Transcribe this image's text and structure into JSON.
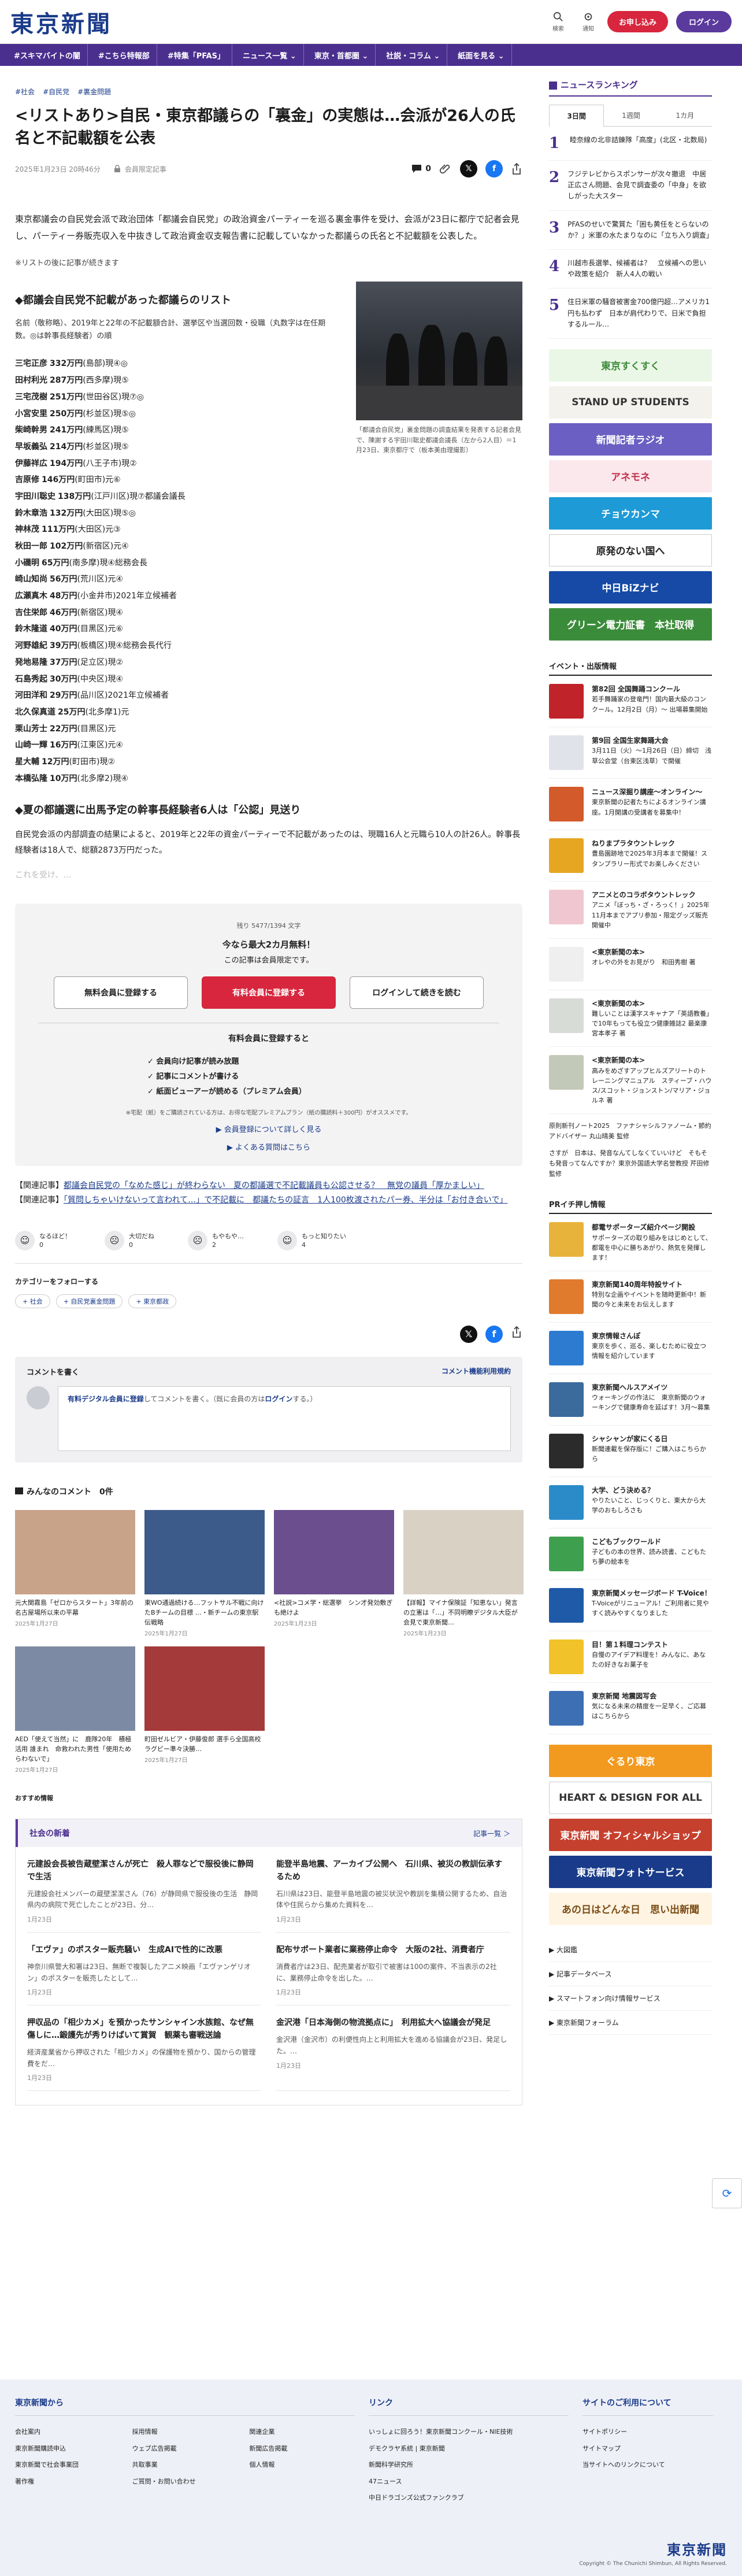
{
  "header": {
    "logo": "東京新聞",
    "search_label": "検索",
    "notice_label": "通知",
    "subscribe": "お申し込み",
    "login": "ログイン"
  },
  "nav": [
    "#スキマバイトの闇",
    "#こちら特報部",
    "#特集「PFAS」",
    "ニュース一覧 ⌄",
    "東京・首都圏 ⌄",
    "社説・コラム ⌄",
    "紙面を見る ⌄"
  ],
  "article": {
    "tags": [
      "#社会",
      "#自民党",
      "#裏金問題"
    ],
    "headline": "<リストあり>自民・東京都議らの「裏金」の実態は…会派が26人の氏名と不記載額を公表",
    "date": "2025年1月23日 20時46分",
    "badge": "会員限定記事",
    "comment_count": "0",
    "lead": "東京都議会の自民党会派で政治団体「都議会自民党」の政治資金パーティーを巡る裏金事件を受け、会派が23日に都庁で記者会見し、パーティー券販売収入を中抜きして政治資金収支報告書に記載していなかった都議らの氏名と不記載額を公表した。",
    "note": "※リストの後に記事が続きます",
    "section1": "◆都議会自民党不記載があった都議らのリスト",
    "list_head": "名前（敬称略）、2019年と22年の不記載額合計、選挙区や当選回数・役職（丸数字は在任期数。◎は幹事長経験者）の順",
    "list": [
      {
        "n": "三宅正彦",
        "v": "332万円",
        "r": "(島部)現④◎"
      },
      {
        "n": "田村利光",
        "v": "287万円",
        "r": "(西多摩)現⑤"
      },
      {
        "n": "三宅茂樹",
        "v": "251万円",
        "r": "(世田谷区)現⑦◎"
      },
      {
        "n": "小宮安里",
        "v": "250万円",
        "r": "(杉並区)現⑤◎"
      },
      {
        "n": "柴崎幹男",
        "v": "241万円",
        "r": "(練馬区)現⑤"
      },
      {
        "n": "早坂義弘",
        "v": "214万円",
        "r": "(杉並区)現⑤"
      },
      {
        "n": "伊藤祥広",
        "v": "194万円",
        "r": "(八王子市)現②"
      },
      {
        "n": "吉原修",
        "v": "146万円",
        "r": "(町田市)元⑥"
      },
      {
        "n": "宇田川聡史",
        "v": "138万円",
        "r": "(江戸川区)現⑦都議会議長"
      },
      {
        "n": "鈴木章浩",
        "v": "132万円",
        "r": "(大田区)現⑤◎"
      },
      {
        "n": "神林茂",
        "v": "111万円",
        "r": "(大田区)元③"
      },
      {
        "n": "秋田一郎",
        "v": "102万円",
        "r": "(新宿区)元④"
      },
      {
        "n": "小磯明",
        "v": "65万円",
        "r": "(南多摩)現④総務会長"
      },
      {
        "n": "崎山知尚",
        "v": "56万円",
        "r": "(荒川区)元④"
      },
      {
        "n": "広瀬真木",
        "v": "48万円",
        "r": "(小金井市)2021年立候補者"
      },
      {
        "n": "吉住栄郎",
        "v": "46万円",
        "r": "(新宿区)現④"
      },
      {
        "n": "鈴木隆道",
        "v": "40万円",
        "r": "(目黒区)元⑥"
      },
      {
        "n": "河野雄紀",
        "v": "39万円",
        "r": "(板橋区)現④総務会長代行"
      },
      {
        "n": "発地易隆",
        "v": "37万円",
        "r": "(足立区)現②"
      },
      {
        "n": "石島秀起",
        "v": "30万円",
        "r": "(中央区)現④"
      },
      {
        "n": "河田洋和",
        "v": "29万円",
        "r": "(品川区)2021年立候補者"
      },
      {
        "n": "北久保真道",
        "v": "25万円",
        "r": "(北多摩1)元"
      },
      {
        "n": "栗山芳士",
        "v": "22万円",
        "r": "(目黒区)元"
      },
      {
        "n": "山崎一輝",
        "v": "16万円",
        "r": "(江東区)元④"
      },
      {
        "n": "星大輔",
        "v": "12万円",
        "r": "(町田市)現②"
      },
      {
        "n": "本橋弘隆",
        "v": "10万円",
        "r": "(北多摩2)現④"
      }
    ],
    "section2": "◆夏の都議選に出馬予定の幹事長経験者6人は「公認」見送り",
    "lead2": "自民党会派の内部調査の結果によると、2019年と22年の資金パーティーで不記載があったのは、現職16人と元職ら10人の計26人。幹事長経験者は18人で、総額2873万円だった。",
    "fade": "これを受け、…",
    "caption": "「都議会自民党」裏金問題の調査結果を発表する記者会見で、陳謝する宇田川聡史都議会議長（左から2人目）＝1月23日、東京都庁で（板本美由理撮影）"
  },
  "paywall": {
    "remaining": "残り 5477/1394 文字",
    "title": "今なら最大2カ月無料！",
    "sub": "この記事は会員限定です。",
    "btn_free": "無料会員に登録する",
    "btn_paid": "有料会員に登録する",
    "btn_login": "ログインして続きを読む",
    "benefit_title": "有料会員に登録すると",
    "benefits": [
      "✓ 会員向け記事が読み放題",
      "✓ 記事にコメントが書ける",
      "✓ 紙面ビューアーが読める（プレミアム会員）"
    ],
    "fine": "※宅配（紙）をご購読されている方は、お得な宅配プレミアムプラン（紙の購読料＋300円）がオススメです。",
    "link1": "▶ 会員登録について詳しく見る",
    "link2": "▶ よくある質問はこちら"
  },
  "related": [
    {
      "pre": "【関連記事】",
      "txt": "都議会自民党の「なめた感じ」が終わらない　夏の都議選で不記載議員も公認させる？　無党の議員「厚かましい」"
    },
    {
      "pre": "【関連記事】",
      "txt": "「質問しちゃいけないって言われて…」で不記載に　都議たちの証言　1人100枚渡されたパー券、半分は「お付き合いで」"
    }
  ],
  "reactions": [
    {
      "face": "☺",
      "label": "なるほど！",
      "count": "0"
    },
    {
      "face": "☹",
      "label": "大切だね",
      "count": "0"
    },
    {
      "face": "☹",
      "label": "もやもや…",
      "count": "2"
    },
    {
      "face": "☺",
      "label": "もっと知りたい",
      "count": "4"
    }
  ],
  "follow": {
    "title": "カテゴリーをフォローする",
    "chips": [
      "+ 社会",
      "+ 自民党裏金問題",
      "+ 東京都政"
    ]
  },
  "comments": {
    "title": "コメントを書く",
    "guide": "コメント機能利用規約",
    "prompt_link": "有料デジタル会員に登録",
    "prompt_rest": "してコメントを書く。（既に会員の方は",
    "prompt_login": "ログイン",
    "prompt_end": "する。）",
    "everyone": "みんなのコメント　0件"
  },
  "cards": [
    {
      "t": "元大関霧島「ゼロからスタート」3年前の名古屋場所以来の平幕",
      "d": "2025年1月27日",
      "c": "#c9a28a"
    },
    {
      "t": "東WO通過続ける…フットサル不戦に向けたBチームの目標 …・新チームの東京駅伝戦略",
      "d": "2025年1月27日",
      "c": "#3c5a8a"
    },
    {
      "t": "<社説>コメ学・総選挙　シン才発効敷ぎも絶けよ",
      "d": "2025年1月23日",
      "c": "#6a4e8e"
    },
    {
      "t": "【詳報】マイナ保険証「知恵ない」発言の立憲は「…」不同明瞭デジタル大臣が会見で東京新聞…",
      "d": "2025年1月23日",
      "c": "#d9d1c4"
    },
    {
      "t": "AED「使えて当然」に　鹿隊20年　積極活用 誰まれ　命救われた男性「使用ためらわないで」",
      "d": "2025年1月27日",
      "c": "#7d8aa3"
    },
    {
      "t": "町田ゼルビア・伊藤俊郎 選手ら全国高校ラグビー準々決勝…",
      "d": "2025年1月27日",
      "c": "#a53a3a"
    }
  ],
  "recommend": "おすすめ情報",
  "newsbox": {
    "title": "社会の新着",
    "more": "記事一覧 ＞",
    "items": [
      {
        "h": "元建設会長被告蔵壁潔さんが死亡　殺人罪などで服役後に静岡で生活",
        "s": "元建設会社メンバーの蔵壁潔潔さん（76）が静岡県で服役後の生活　静岡県内の病院で死亡したことが23日、分…",
        "d": "1月23日"
      },
      {
        "h": "能登半島地震、アーカイブ公開へ　石川県、被災の教訓伝承するため",
        "s": "石川県は23日、能登半島地震の被災状況や教訓を集積公開するため、自治体や住民らから集めた資料を…",
        "d": "1月23日"
      },
      {
        "h": "「エヴァ」のポスター販売騒い　生成AIで性的に改悪",
        "s": "神奈川県警大和署は23日、無断で複製したアニメ映画「エヴァンゲリオン」のポスターを販売したとして…",
        "d": "1月23日"
      },
      {
        "h": "配布サポート業者に業務停止命令　大阪の2社、消費者庁",
        "s": "消費者庁は23日、配売業者が取引で被害は100の案件、不当表示の2社に、業務停止命令を出した。…",
        "d": "1月23日"
      },
      {
        "h": "押収品の「相少カメ」を預かったサンシャイン水族館、なぜ無傷しに…鍛護先が秀りけばいて賞賀　観薬も審戦送論",
        "s": "経済産業省から押収された「相少カメ」の保護物を預かり、国からの管理費をだ…",
        "d": "1月23日"
      },
      {
        "h": "金沢港「日本海側の物流拠点に」　利用拡大へ協議会が発足",
        "s": "金沢港（金沢市）の利便性向上と利用拡大を進める協議会が23日、発足した。…",
        "d": "1月23日"
      }
    ]
  },
  "ranking": {
    "title": "ニュースランキング",
    "tabs": [
      "3日間",
      "1週間",
      "1カ月"
    ],
    "items": [
      "睦奈線の北非詰錬隊「高度」(北区・北数局)",
      "フジテレビからスポンサーが次々撤退　中居正広さん問題、会見で調査委の「中身」を欲しがった大スター",
      "PFASのせいで驚質た「困も黄任をとらないのか？」米軍の水たまりなのに「立ち入り調査」",
      "川越市長選挙、候補者は？　立候補への思いや政策を紹介　新人4人の戦い",
      "住日米軍の騒音被害金700億円超…アメリカ1円も払わず　日本が肩代わりで、日米で負担するルール…"
    ]
  },
  "banners": [
    {
      "t": "東京すくすく",
      "bg": "#eaf7e6",
      "fg": "#3c8b3a"
    },
    {
      "t": "STAND UP STUDENTS",
      "bg": "#f4f2ed",
      "fg": "#333"
    },
    {
      "t": "新聞記者ラジオ",
      "bg": "#6b5fc3",
      "fg": "#fff"
    },
    {
      "t": "アネモネ",
      "bg": "#fbe8ec",
      "fg": "#c1304b"
    },
    {
      "t": "チョウカンマ",
      "bg": "#1e9ad6",
      "fg": "#fff"
    },
    {
      "t": "原発のない国へ",
      "bg": "#ffffff",
      "fg": "#222"
    },
    {
      "t": "中日BiZナビ",
      "bg": "#164aa6",
      "fg": "#fff"
    },
    {
      "t": "グリーン電力証書　本社取得",
      "bg": "#3b8c3a",
      "fg": "#fff"
    }
  ],
  "events": {
    "title": "イベント・出版情報",
    "items": [
      {
        "b": "第82回 全国舞踊コンクール",
        "t": "若手舞踊家の登竜門！国内最大級のコンクール。12月2日（月）〜 出場募集開始",
        "c": "#c0232a"
      },
      {
        "b": "第9回 全国生家舞踊大会",
        "t": "3月11日（火）〜1月26日（日）締切　浅草公会堂（台東区浅草）で開催",
        "c": "#e1e3ea"
      },
      {
        "b": "ニュース深掘り講座〜オンライン〜",
        "t": "東京新聞の記者たちによるオンライン講座。1月開講の受講者を募集中！",
        "c": "#d35a2a"
      },
      {
        "b": "ねりまプラタウントレック",
        "t": "豊島園跡地で2025年3月本まで開催！スタンプラリー形式でお楽しみください",
        "c": "#e6a622"
      },
      {
        "b": "アニメとのコラボタウントレック",
        "t": "アニメ「ぼっち・ざ・ろっく！」2025年11月本までアプリ参加・限定グッズ販売開催中",
        "c": "#f0c7d0"
      },
      {
        "b": "<東京新聞の本>",
        "t": "オレやの外をお見がり　和田秀樹 著",
        "c": "#efefef"
      },
      {
        "b": "<東京新聞の本>",
        "t": "難しいことは漢字スキャナア「英語教養」で10年もっても役立つ健康雑誌2 最楽康 宮本孝子 著",
        "c": "#d7dcd6"
      },
      {
        "b": "<東京新聞の本>",
        "t": "高みをめざすアップヒルズアリートのトレーニングマニュアル　スティーブ・ハウス/スコット・ジョンストン/マリア・ジョルネ 著",
        "c": "#c3c9b8"
      }
    ],
    "extra1": "原則新刊ノート2025　ファナシャシルファノーム・節約アドバイザー 丸山晴美 監修",
    "extra2": "さすが　日本は、発音なんてしなくていいけど　そもそも発音ってなんですか？東京外国語大学名誉教授 芹田修 監修"
  },
  "pr": {
    "title": "PRイチ押し情報",
    "items": [
      {
        "b": "都電サポーターズ紹介ページ開設",
        "t": "サポーターズの取り組みをはじめとして、都電を中心に勝ちあがり、熱気を発揮します！",
        "c": "#e8b33a"
      },
      {
        "b": "東京新聞140周年特設サイト",
        "t": "特別な企画やイベントを随時更新中！新聞の今と未来をお伝えします",
        "c": "#e07a2c"
      },
      {
        "b": "東京情報さんぽ",
        "t": "東京を歩く、巡る、楽しむために役立つ情報を紹介しています",
        "c": "#2c7bd0"
      },
      {
        "b": "東京新聞ヘルスアメイツ",
        "t": "ウォーキングの作法に　東京新聞のウォーキングで健康寿命を延ばす！3月〜募集",
        "c": "#3a6b9c"
      },
      {
        "b": "シャシャンが家にくる日",
        "t": "新聞連載を保存版に！ご購入はこちらから",
        "c": "#2b2b2b"
      },
      {
        "b": "大学、どう決める？",
        "t": "やりたいこと、じっくりと、東大から大学のおもしろさも",
        "c": "#2b8bc9"
      },
      {
        "b": "こどもブックワールド",
        "t": "子どもの本の世界、読み読書、こどもたち夢の絵本を",
        "c": "#3ea04f"
      },
      {
        "b": "東京新聞メッセージボード T-Voice！",
        "t": "T-Voiceがリニューアル！ご利用者に見やすく読みやすくなりました",
        "c": "#1e5aa8"
      },
      {
        "b": "目！第１料理コンテスト",
        "t": "自慢のアイデア料理を！みんなに、あなたの好きなお菓子を",
        "c": "#f2c22a"
      },
      {
        "b": "東京新聞 地震図写会",
        "t": "気になる未来の精度を一足早く、ご応募はこちらから",
        "c": "#3d6fb5"
      }
    ]
  },
  "banners2": [
    {
      "t": "ぐるり東京",
      "bg": "#f29a1f",
      "fg": "#fff"
    },
    {
      "t": "HEART & DESIGN FOR ALL",
      "bg": "#ffffff",
      "fg": "#333"
    },
    {
      "t": "東京新聞 オフィシャルショップ",
      "bg": "#c6402e",
      "fg": "#fff"
    },
    {
      "t": "東京新聞フォトサービス",
      "bg": "#1a3b8a",
      "fg": "#fff"
    },
    {
      "t": "あの日はどんな日　思い出新聞",
      "bg": "#fff4e2",
      "fg": "#7a4b15"
    }
  ],
  "side_links": [
    "▶ 大図鑑",
    "▶ 記事データベース",
    "▶ スマートフォン向け情報サービス",
    "▶ 東京新聞フォーラム"
  ],
  "footer": {
    "col1": "東京新聞から",
    "links1": [
      "会社案内",
      "採用情報",
      "関連企業",
      "東京新聞購読申込",
      "ウェブ広告掲載",
      "新聞広告掲載",
      "東京新聞で社会事業団",
      "共取事業",
      "個人情報",
      "著作権",
      "ご質問・お問い合わせ"
    ],
    "col2": "リンク",
    "links2": [
      "いっしょに回ろう！東京新聞コンクール・NIE技術",
      "デモクラヤ系統 | 東京新聞",
      "新聞科学研究所",
      "47ニュース",
      "中日ドラゴンズ公式ファンクラブ"
    ],
    "col3": "サイトのご利用について",
    "links3": [
      "サイトポリシー",
      "サイトマップ",
      "当サイトへのリンクについて"
    ],
    "logo": "東京新聞",
    "copy": "Copyright © The Chunichi Shimbun, All Rights Reserved."
  }
}
